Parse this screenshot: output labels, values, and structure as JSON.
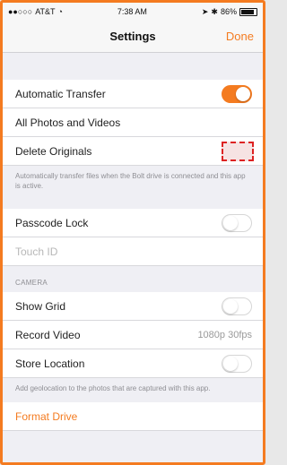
{
  "status_bar": {
    "carrier": "AT&T",
    "time": "7:38 AM",
    "battery": "86%",
    "battery_level": 0.86
  },
  "nav": {
    "title": "Settings",
    "done_label": "Done"
  },
  "transfer": {
    "automatic_transfer_label": "Automatic Transfer",
    "automatic_transfer_on": true,
    "all_photos_label": "All Photos and Videos",
    "delete_originals_label": "Delete Originals",
    "footer": "Automatically transfer files when the Bolt drive is connected and this app is active."
  },
  "security": {
    "passcode_lock_label": "Passcode Lock",
    "passcode_lock_on": false,
    "touch_id_label": "Touch ID"
  },
  "camera": {
    "header": "CAMERA",
    "show_grid_label": "Show Grid",
    "show_grid_on": false,
    "record_video_label": "Record Video",
    "record_video_value": "1080p 30fps",
    "store_location_label": "Store Location",
    "store_location_on": false,
    "footer": "Add geolocation to the photos that are captured with this app."
  },
  "drive": {
    "format_drive_label": "Format Drive"
  },
  "colors": {
    "accent": "#f47b20",
    "annotation": "#dd2222"
  }
}
